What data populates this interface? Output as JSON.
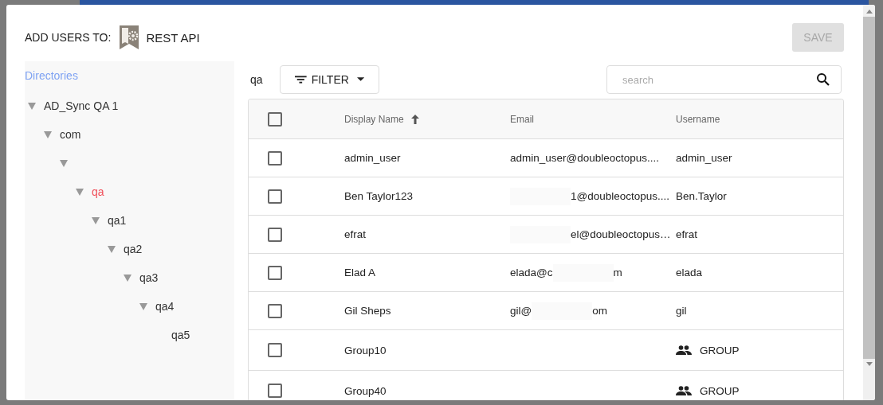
{
  "dialog": {
    "heading": "ADD USERS TO:",
    "app_name": "REST API",
    "save_button": {
      "label": "SAVE",
      "disabled": true
    }
  },
  "directories": {
    "title": "Directories",
    "tree": [
      {
        "label": "AD_Sync QA 1",
        "selected": false,
        "expanded": true,
        "children": [
          {
            "label": "com",
            "selected": false,
            "expanded": true,
            "children": [
              {
                "expanded": true,
                "children": [
                  {
                    "label": "qa",
                    "selected": true,
                    "expanded": true,
                    "children": [
                      {
                        "label": "qa1",
                        "selected": false,
                        "expanded": true,
                        "children": [
                          {
                            "label": "qa2",
                            "selected": false,
                            "expanded": true,
                            "children": [
                              {
                                "label": "qa3",
                                "selected": false,
                                "expanded": true,
                                "children": [
                                  {
                                    "label": "qa4",
                                    "selected": false,
                                    "expanded": true,
                                    "children": [
                                      {
                                        "label": "qa5",
                                        "selected": false
                                      }
                                    ]
                                  }
                                ]
                              }
                            ]
                          }
                        ]
                      }
                    ]
                  }
                ]
              }
            ]
          }
        ]
      }
    ]
  },
  "toolbar": {
    "current_directory": "qa",
    "filter_label": "FILTER",
    "search": {
      "placeholder": "search"
    }
  },
  "table": {
    "select_all_checked": false,
    "columns": [
      {
        "label": "Display Name",
        "sorted": true
      },
      {
        "label": "Email"
      },
      {
        "label": "Username"
      }
    ],
    "rows": [
      {
        "checked": false,
        "display_name": "admin_user",
        "email": [
          {
            "kind": "text",
            "text": "admin_user@doubleoctopus...."
          }
        ],
        "username": "admin_user",
        "kind": "user"
      },
      {
        "checked": false,
        "display_name": "Ben Taylor123",
        "email": [
          {
            "kind": "redaction"
          },
          {
            "kind": "text",
            "text": "1@doubleoctopus...."
          }
        ],
        "username": "Ben.Taylor",
        "kind": "user"
      },
      {
        "checked": false,
        "display_name": "efrat",
        "email": [
          {
            "kind": "redaction"
          },
          {
            "kind": "text",
            "text": "el@doubleoctopus…"
          }
        ],
        "username": "efrat",
        "kind": "user"
      },
      {
        "checked": false,
        "display_name": "Elad A",
        "email": [
          {
            "kind": "text",
            "text": "elada@c"
          },
          {
            "kind": "redaction"
          },
          {
            "kind": "text",
            "text": "m"
          }
        ],
        "username": "elada",
        "kind": "user"
      },
      {
        "checked": false,
        "display_name": "Gil Sheps",
        "email": [
          {
            "kind": "text",
            "text": "gil@"
          },
          {
            "kind": "redaction"
          },
          {
            "kind": "text",
            "text": "om"
          }
        ],
        "username": "gil",
        "kind": "user"
      },
      {
        "checked": false,
        "display_name": "Group10",
        "username": "GROUP",
        "kind": "group"
      },
      {
        "checked": false,
        "display_name": "Group40",
        "username": "GROUP",
        "kind": "group"
      }
    ]
  }
}
